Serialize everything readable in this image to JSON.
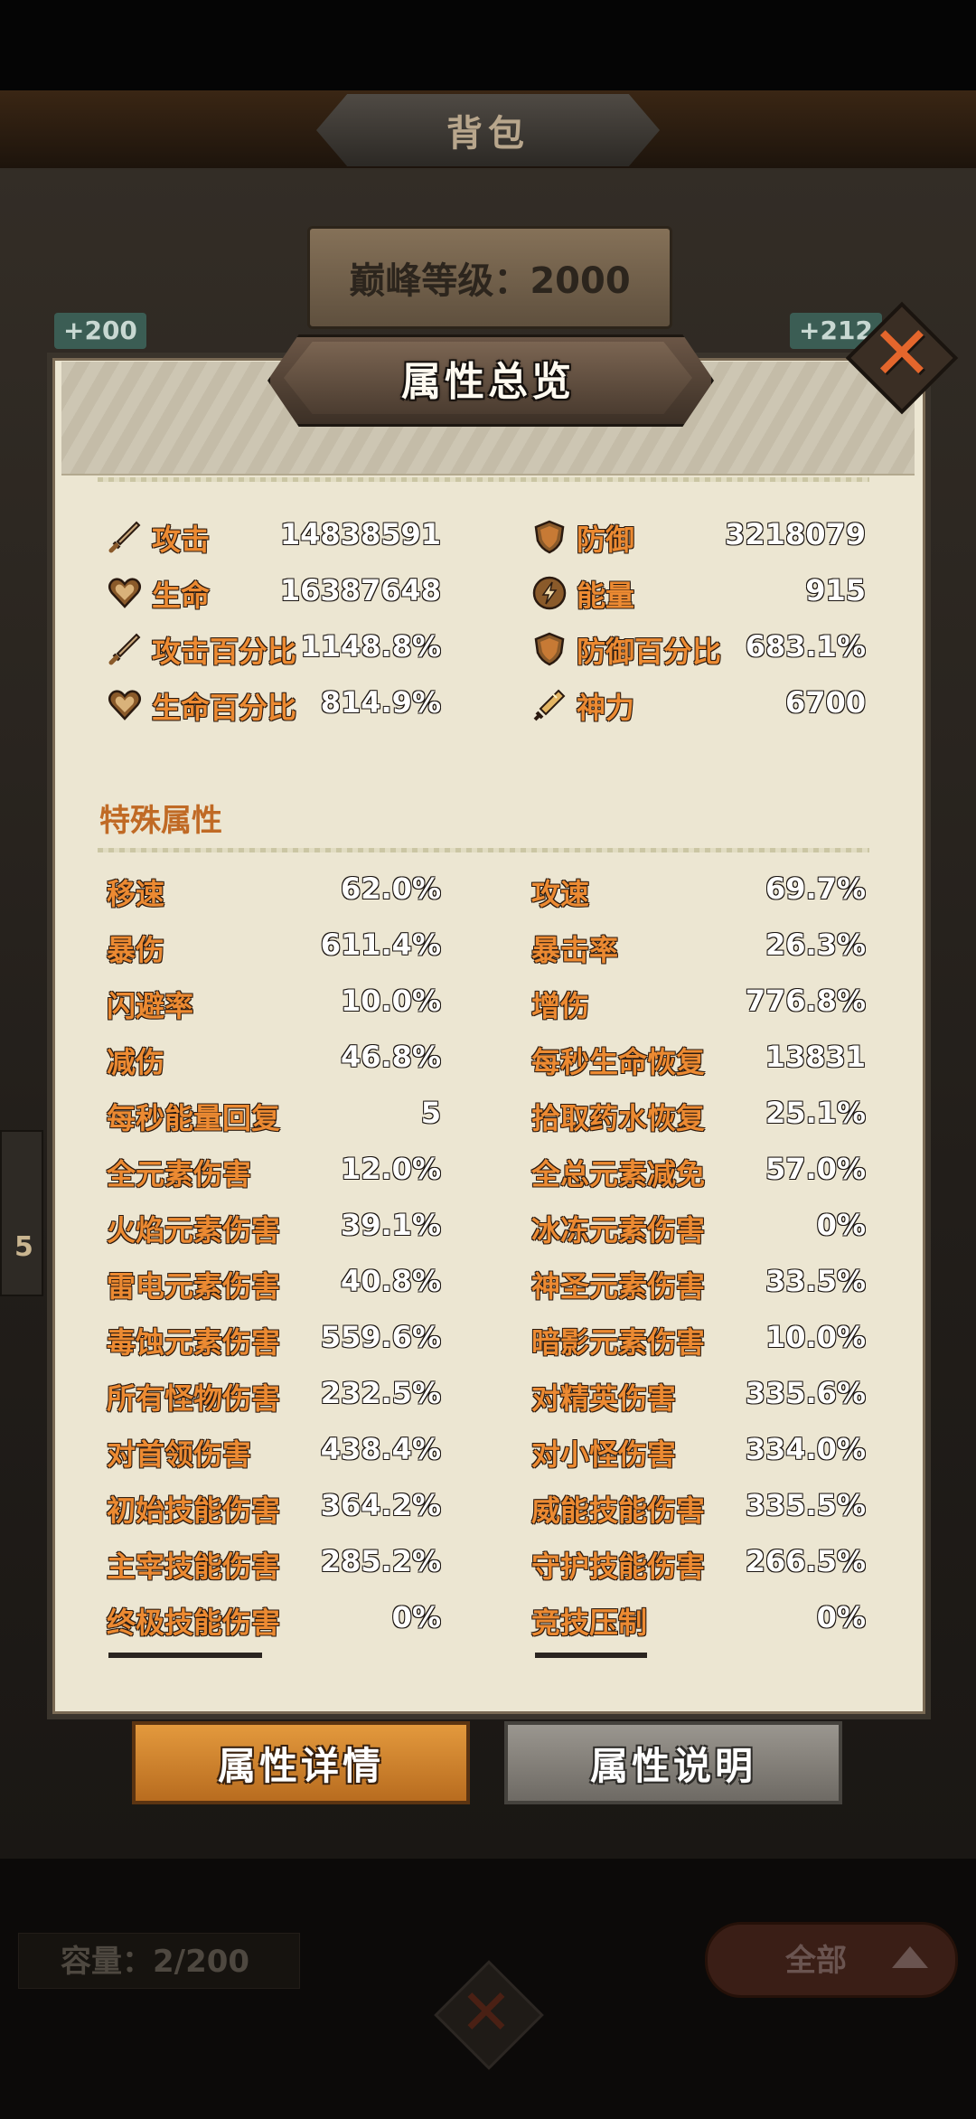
{
  "header": {
    "title": "背包"
  },
  "background": {
    "peak_level": "巅峰等级：2000",
    "badge_left": "+200",
    "badge_right": "+212",
    "side_number": "5",
    "capacity": "容量：2/200",
    "filter_label": "全部"
  },
  "modal": {
    "title": "属性总览",
    "core_stats": [
      {
        "icon": "sword-icon",
        "label": "攻击",
        "value": "14838591"
      },
      {
        "icon": "shield-icon",
        "label": "防御",
        "value": "3218079"
      },
      {
        "icon": "heart-icon",
        "label": "生命",
        "value": "16387648"
      },
      {
        "icon": "energy-icon",
        "label": "能量",
        "value": "915"
      },
      {
        "icon": "sword-icon",
        "label": "攻击百分比",
        "value": "1148.8%"
      },
      {
        "icon": "shield-icon",
        "label": "防御百分比",
        "value": "683.1%"
      },
      {
        "icon": "heart-icon",
        "label": "生命百分比",
        "value": "814.9%"
      },
      {
        "icon": "divine-power-icon",
        "label": "神力",
        "value": "6700"
      }
    ],
    "special_title": "特殊属性",
    "special_stats": [
      {
        "label": "移速",
        "value": "62.0%"
      },
      {
        "label": "攻速",
        "value": "69.7%"
      },
      {
        "label": "暴伤",
        "value": "611.4%"
      },
      {
        "label": "暴击率",
        "value": "26.3%"
      },
      {
        "label": "闪避率",
        "value": "10.0%"
      },
      {
        "label": "增伤",
        "value": "776.8%"
      },
      {
        "label": "减伤",
        "value": "46.8%"
      },
      {
        "label": "每秒生命恢复",
        "value": "13831"
      },
      {
        "label": "每秒能量回复",
        "value": "5"
      },
      {
        "label": "拾取药水恢复",
        "value": "25.1%"
      },
      {
        "label": "全元素伤害",
        "value": "12.0%"
      },
      {
        "label": "全总元素减免",
        "value": "57.0%"
      },
      {
        "label": "火焰元素伤害",
        "value": "39.1%"
      },
      {
        "label": "冰冻元素伤害",
        "value": "0%"
      },
      {
        "label": "雷电元素伤害",
        "value": "40.8%"
      },
      {
        "label": "神圣元素伤害",
        "value": "33.5%"
      },
      {
        "label": "毒蚀元素伤害",
        "value": "559.6%"
      },
      {
        "label": "暗影元素伤害",
        "value": "10.0%"
      },
      {
        "label": "所有怪物伤害",
        "value": "232.5%"
      },
      {
        "label": "对精英伤害",
        "value": "335.6%"
      },
      {
        "label": "对首领伤害",
        "value": "438.4%"
      },
      {
        "label": "对小怪伤害",
        "value": "334.0%"
      },
      {
        "label": "初始技能伤害",
        "value": "364.2%"
      },
      {
        "label": "威能技能伤害",
        "value": "335.5%"
      },
      {
        "label": "主宰技能伤害",
        "value": "285.2%"
      },
      {
        "label": "守护技能伤害",
        "value": "266.5%"
      },
      {
        "label": "终极技能伤害",
        "value": "0%"
      },
      {
        "label": "竞技压制",
        "value": "0%"
      }
    ],
    "buttons": {
      "details": "属性详情",
      "explain": "属性说明"
    }
  },
  "colors": {
    "label_orange": "#ec8a32",
    "section_orange": "#c06a25",
    "parchment": "#ece6d2",
    "close_orange": "#e4662c"
  }
}
